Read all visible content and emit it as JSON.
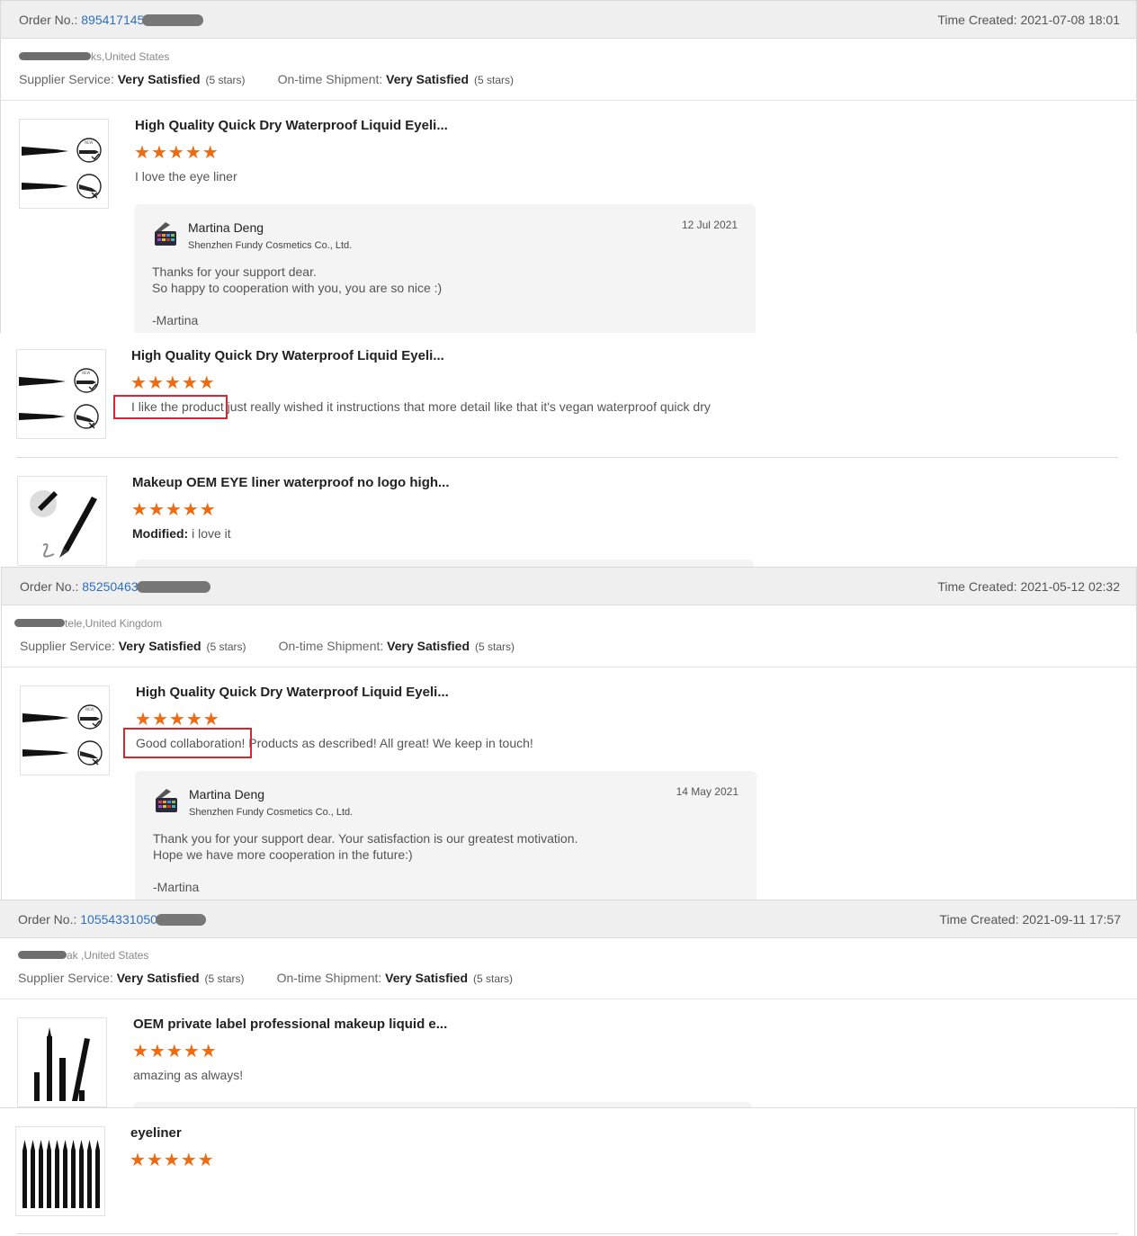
{
  "labels": {
    "order_no": "Order No.: ",
    "time_created": "Time Created: ",
    "supplier_service": "Supplier Service: ",
    "ontime_shipment": "On-time Shipment: ",
    "stars_suffix": "(5 stars)",
    "modified": "Modified: "
  },
  "orders": [
    {
      "order_no": "895417145",
      "time": "2021-07-08 18:01",
      "buyer_location": "ks,United States",
      "supplier_service": "Very Satisfied",
      "ontime_shipment": "Very Satisfied",
      "reviews": [
        {
          "title": "High Quality Quick Dry Waterproof Liquid Eyeli...",
          "rating": 5,
          "comment": "I love the eye liner",
          "reply": {
            "name": "Martina Deng",
            "company": "Shenzhen Fundy Cosmetics Co., Ltd.",
            "date": "12 Jul 2021",
            "line1": "Thanks for your support dear.",
            "line2": "So happy to cooperation with you, you are so nice :)",
            "signature": "-Martina"
          }
        },
        {
          "title": "High Quality Quick Dry Waterproof Liquid Eyeli...",
          "rating": 5,
          "comment_highlight": "I like the product",
          "comment_rest": " just really wished it instructions that more detail like that it's vegan waterproof quick dry"
        },
        {
          "title": "Makeup OEM EYE liner waterproof no logo high...",
          "rating": 5,
          "modified_comment": "i love it"
        }
      ]
    },
    {
      "order_no": "85250463",
      "time": "2021-05-12 02:32",
      "buyer_location": "tele,United Kingdom",
      "supplier_service": "Very Satisfied",
      "ontime_shipment": "Very Satisfied",
      "reviews": [
        {
          "title": "High Quality Quick Dry Waterproof Liquid Eyeli...",
          "rating": 5,
          "comment_highlight": "Good collaboration!",
          "comment_rest": " Products as described! All great! We keep in touch!",
          "reply": {
            "name": "Martina Deng",
            "company": "Shenzhen Fundy Cosmetics Co., Ltd.",
            "date": "14 May 2021",
            "line1": "Thank you for your support dear. Your satisfaction is our greatest motivation.",
            "line2": "Hope we have more cooperation in the future:)",
            "signature": "-Martina"
          }
        }
      ]
    },
    {
      "order_no": "10554331050",
      "time": "2021-09-11 17:57",
      "buyer_location": "ak ,United States",
      "supplier_service": "Very Satisfied",
      "ontime_shipment": "Very Satisfied",
      "reviews": [
        {
          "title": "OEM private label professional makeup liquid e...",
          "rating": 5,
          "comment": "amazing as always!"
        },
        {
          "title": "eyeliner",
          "rating": 5
        }
      ]
    }
  ],
  "colors": {
    "star": "#f06a0f",
    "order_link": "#2c6fc4",
    "highlight": "#d9262c",
    "header_bg": "#efefef",
    "reply_bg": "#f4f4f4"
  }
}
